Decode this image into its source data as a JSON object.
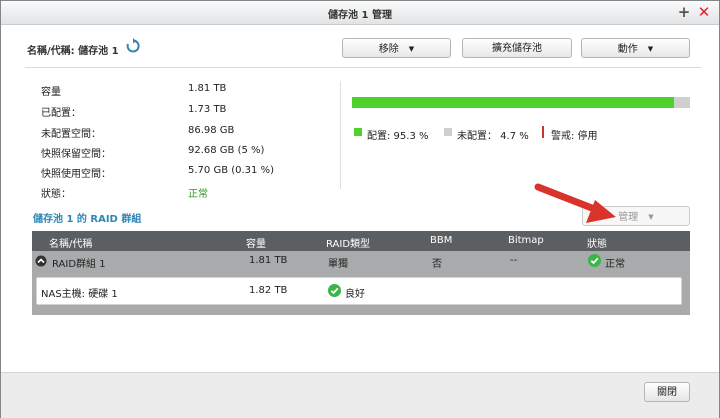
{
  "window": {
    "title": "儲存池 1 管理",
    "plus_glyph": "+",
    "close_glyph": "✕"
  },
  "header": {
    "name_label": "名稱/代稱: 儲存池 1",
    "buttons": {
      "remove": "移除",
      "expand": "擴充儲存池",
      "action": "動作"
    }
  },
  "info": {
    "rows": [
      {
        "label": "容量",
        "value": "1.81 TB"
      },
      {
        "label": "已配置：",
        "value": "1.73 TB"
      },
      {
        "label": "未配置空間：",
        "value": "86.98 GB"
      },
      {
        "label": "快照保留空間：",
        "value": "92.68 GB (5 %)"
      },
      {
        "label": "快照使用空間：",
        "value": "5.70 GB (0.31 %)"
      },
      {
        "label": "狀態：",
        "value": "正常"
      }
    ]
  },
  "usage": {
    "allocated_fraction": 0.953,
    "allocated_color": "#4ed12a",
    "unallocated_color": "#cfcfcf",
    "warning_color": "#c0392b",
    "legend": {
      "allocated": "配置: 95.3 %",
      "unallocated": "未配置： 4.7 %",
      "warning": "警戒: 停用"
    }
  },
  "raid": {
    "title": "儲存池 1 的 RAID 群組",
    "manage_button": "管理",
    "columns": [
      "名稱/代稱",
      "容量",
      "RAID類型",
      "BBM",
      "Bitmap",
      "狀態"
    ],
    "group": {
      "name": "RAID群組 1",
      "capacity": "1.81 TB",
      "type": "單獨",
      "bbm": "否",
      "bitmap": "--",
      "status": "正常"
    },
    "disk": {
      "name": "NAS主機: 硬碟 1",
      "capacity": "1.82 TB",
      "status": "良好"
    }
  },
  "footer": {
    "close_button": "關閉"
  },
  "icons": {
    "refresh": "refresh-icon",
    "dropdown": "chevron-down-icon",
    "expand": "collapse-icon",
    "check": "check-circle-icon",
    "annotation": "red-arrow"
  }
}
